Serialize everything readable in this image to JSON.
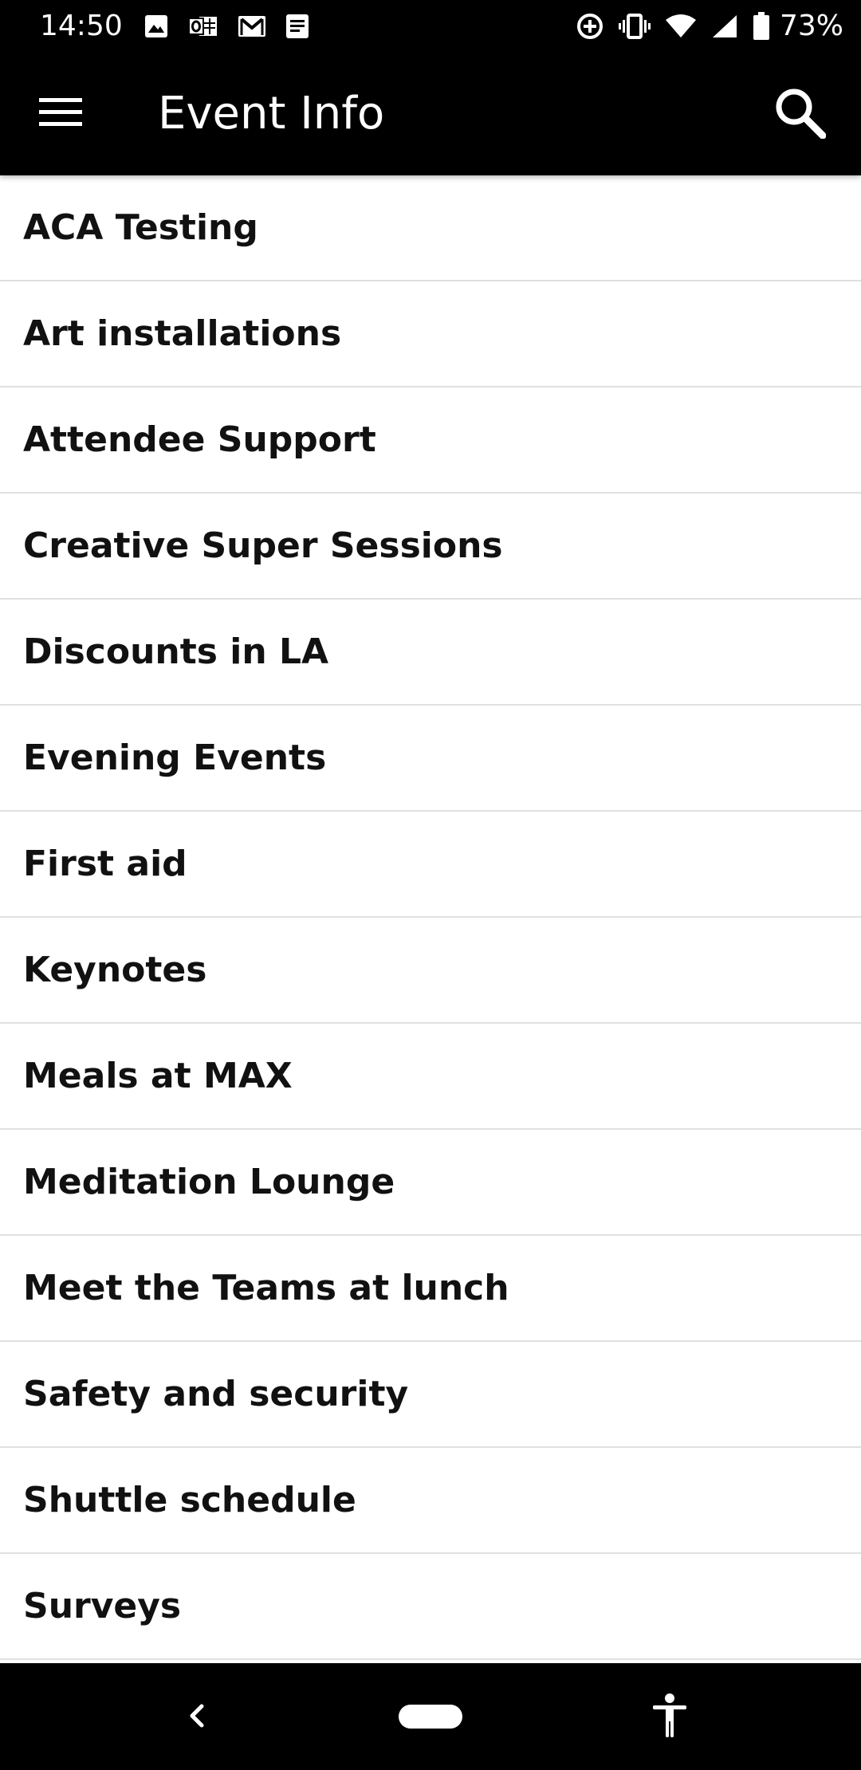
{
  "status_bar": {
    "time": "14:50",
    "battery_percent": "73%",
    "left_icons": [
      "image-icon",
      "outlook-icon",
      "gmail-icon",
      "docs-icon"
    ],
    "right_icons": [
      "data-saver-icon",
      "vibrate-icon",
      "wifi-icon",
      "signal-icon",
      "battery-icon"
    ]
  },
  "app_bar": {
    "title": "Event Info",
    "menu_icon": "hamburger-menu-icon",
    "search_icon": "search-icon"
  },
  "list": {
    "items": [
      {
        "label": "ACA Testing"
      },
      {
        "label": "Art installations"
      },
      {
        "label": "Attendee Support"
      },
      {
        "label": "Creative Super Sessions"
      },
      {
        "label": "Discounts in LA"
      },
      {
        "label": "Evening Events"
      },
      {
        "label": "First aid"
      },
      {
        "label": "Keynotes"
      },
      {
        "label": "Meals at MAX"
      },
      {
        "label": "Meditation Lounge"
      },
      {
        "label": "Meet the Teams at lunch"
      },
      {
        "label": "Safety and security"
      },
      {
        "label": "Shuttle schedule"
      },
      {
        "label": "Surveys"
      }
    ]
  },
  "nav_bar": {
    "back_icon": "back-chevron-icon",
    "home_icon": "home-pill-icon",
    "accessibility_icon": "accessibility-icon"
  },
  "colors": {
    "app_bar_background": "#000000",
    "list_background": "#ffffff",
    "divider": "#e0e0e0",
    "text_primary": "#111111"
  }
}
